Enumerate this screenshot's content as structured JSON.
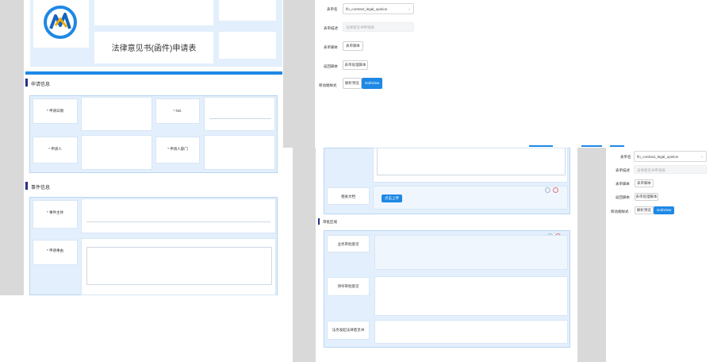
{
  "form": {
    "title": "法律意见书(函件)申请表",
    "section_apply": "申请信息",
    "section_event": "事件信息",
    "apply_date_label": "* 申请日期",
    "no_label": "* NO.",
    "applicant_label": "* 申请人",
    "dept_label": "* 申请人部门",
    "subject_label": "* 事件主体",
    "reason_label": "* 申请事由"
  },
  "props_top": {
    "table_name_label": "表单名",
    "table_name_value": "lfo_contract_legal_opinion",
    "desc_label": "表单描述",
    "desc_placeholder": "法律意见书申请表",
    "script_label": "表单脚本",
    "script_button": "表单脚本",
    "return_label": "返回脚本",
    "return_button": "表单处理脚本",
    "mobile_label": "移动端样式",
    "mobile_opt1": "解析预览",
    "mobile_opt2": "mobView"
  },
  "form_bottom": {
    "attachment_label": "相关文档",
    "upload_button": "点击上传",
    "section_review": "审批区域",
    "review1_label": "业务审批意见",
    "review2_label": "领导审批意见",
    "review3_label": "法务发起法律意见书"
  },
  "props_bottom": {
    "table_name_label": "表单名",
    "table_name_value": "lfo_contract_legal_opinion",
    "desc_label": "表单描述",
    "desc_placeholder": "法律意见书申请表",
    "script_label": "表单脚本",
    "script_button": "表单脚本",
    "return_label": "返回脚本",
    "return_button": "表单处理脚本",
    "mobile_label": "移动端样式",
    "mobile_opt1": "解析预览",
    "mobile_opt2": "mobView"
  },
  "colors": {
    "accent_blue": "#1e88e5",
    "section_bar": "#2a2f88",
    "cell_bg": "#e3effc"
  }
}
